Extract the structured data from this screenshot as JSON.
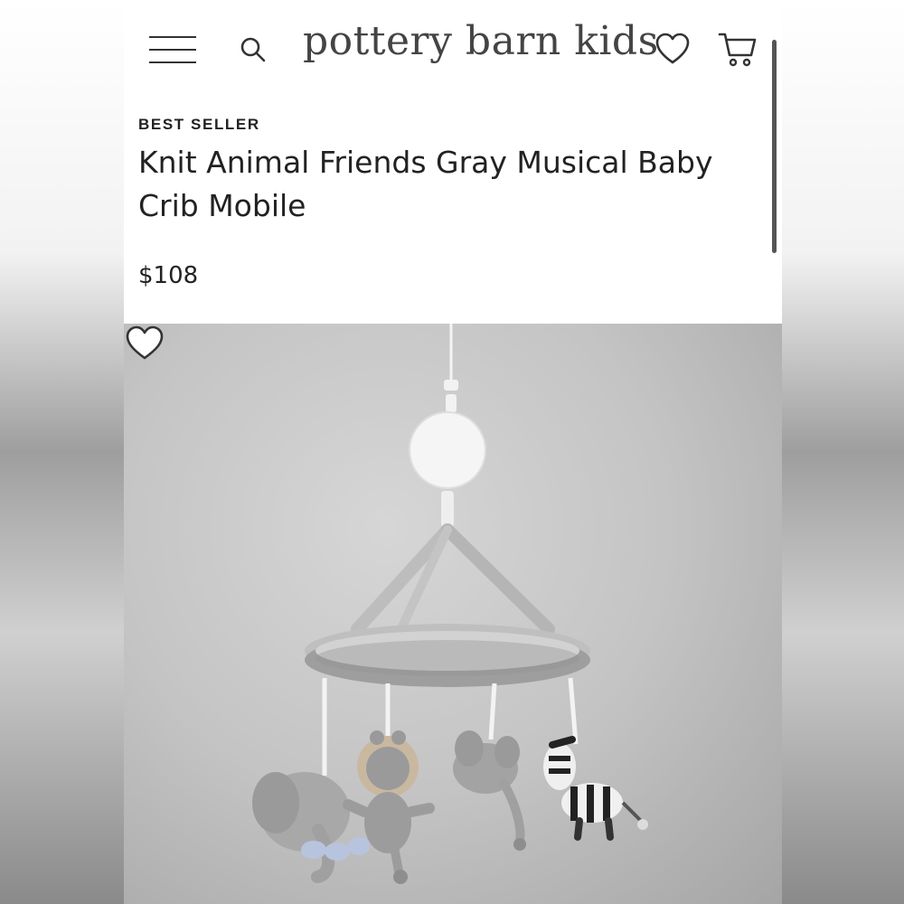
{
  "header": {
    "menu_icon": "hamburger-menu-icon",
    "search_icon": "search-icon",
    "brand": "pottery barn kids",
    "wishlist_icon": "heart-icon",
    "cart_icon": "cart-icon"
  },
  "product": {
    "badge": "BEST SELLER",
    "title": "Knit Animal Friends Gray Musical Baby Crib Mobile",
    "price": "$108",
    "favorite_icon": "heart-icon"
  },
  "colors": {
    "text": "#222222",
    "logo": "#444444",
    "background": "#ffffff"
  }
}
